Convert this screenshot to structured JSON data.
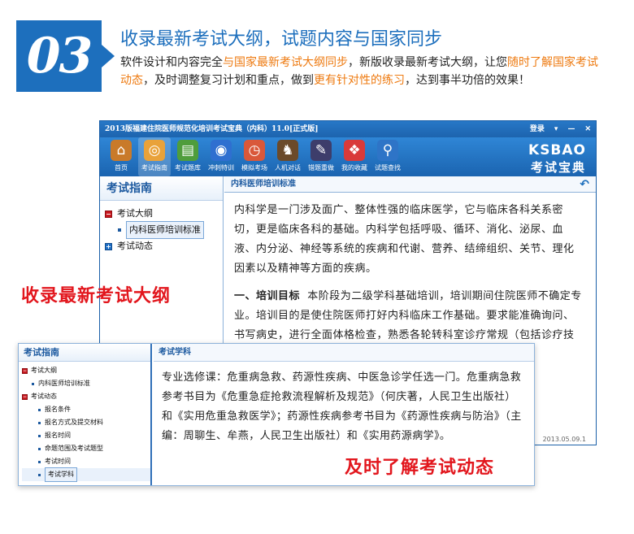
{
  "promo": {
    "number": "03",
    "headline": "收录最新考试大纲，试题内容与国家同步",
    "desc_parts": [
      {
        "text": "软件设计和内容完全",
        "hl": false
      },
      {
        "text": "与国家最新考试大纲同步",
        "hl": true
      },
      {
        "text": "，新版收录最新考试大纲，让您",
        "hl": false
      },
      {
        "text": "随时了解国家考试动态",
        "hl": true
      },
      {
        "text": "，及时调整复习计划和重点，做到",
        "hl": false
      },
      {
        "text": "更有针对性的练习",
        "hl": true
      },
      {
        "text": "，达到事半功倍的效果！",
        "hl": false
      }
    ],
    "highlight_color": "#ee7a10",
    "accent_color": "#1d6fbd"
  },
  "app": {
    "title": "2013版福建住院医师规范化培训考试宝典（内科）11.0[正式版]",
    "login": "登录",
    "controls": [
      "▾",
      "—",
      "✕"
    ],
    "toolbar": [
      {
        "label": "首页",
        "icon": "home-icon",
        "glyph": "⌂",
        "bg": "#c97a2a",
        "active": false
      },
      {
        "label": "考试指南",
        "icon": "compass-icon",
        "glyph": "◎",
        "bg": "#e9a23a",
        "active": true
      },
      {
        "label": "考试题库",
        "icon": "books-icon",
        "glyph": "▤",
        "bg": "#4f9d3c",
        "active": false
      },
      {
        "label": "冲刺特训",
        "icon": "globe-icon",
        "glyph": "◉",
        "bg": "#2f6fd0",
        "active": false
      },
      {
        "label": "模拟考场",
        "icon": "clock-icon",
        "glyph": "◷",
        "bg": "#d9583a",
        "active": false
      },
      {
        "label": "人机对话",
        "icon": "chess-icon",
        "glyph": "♞",
        "bg": "#6b4a2a",
        "active": false
      },
      {
        "label": "错题重做",
        "icon": "pen-icon",
        "glyph": "✎",
        "bg": "#3d3d6b",
        "active": false
      },
      {
        "label": "我的收藏",
        "icon": "gift-icon",
        "glyph": "❖",
        "bg": "#d93a3a",
        "active": false
      },
      {
        "label": "试题查找",
        "icon": "magnifier-icon",
        "glyph": "⚲",
        "bg": "#2e74c7",
        "active": false
      }
    ],
    "brand_en": "KSBAO",
    "brand_cn": "考试宝典",
    "sidebar": {
      "title": "考试指南",
      "items": [
        {
          "label": "考试大纲",
          "kind": "expanded"
        },
        {
          "label": "内科医师培训标准",
          "kind": "child-selected"
        },
        {
          "label": "考试动态",
          "kind": "collapsed"
        }
      ]
    },
    "content": {
      "heading": "内科医师培训标准",
      "para1": "内科学是一门涉及面广、整体性强的临床医学，它与临床各科关系密切，更是临床各科的基础。内科学包括呼吸、循环、消化、泌尿、血液、内分泌、神经等系统的疾病和代谢、营养、结缔组织、关节、理化因素以及精神等方面的疾病。",
      "para2_bold": "一、培训目标",
      "para2": "本阶段为二级学科基础培训，培训期间住院医师不确定专业。培训目的是使住院医师打好内科临床工作基础。要求能准确询问、书写病史，进行全面体格检查，熟悉各轮转科室诊疗常规（包括诊疗技术），基本掌握门、急诊常见疾病的诊断和处理，国外"
    },
    "status": "2013.05.09.1"
  },
  "overlay1": "收录最新考试大纲",
  "panel2": {
    "sidebar_title": "考试指南",
    "items": [
      {
        "label": "考试大纲",
        "kind": "expanded"
      },
      {
        "label": "内科医师培训标准",
        "kind": "child"
      },
      {
        "label": "考试动态",
        "kind": "expanded"
      },
      {
        "label": "报名条件",
        "kind": "grandchild"
      },
      {
        "label": "报名方式及提交材料",
        "kind": "grandchild"
      },
      {
        "label": "报名时间",
        "kind": "grandchild"
      },
      {
        "label": "命题范围及考试题型",
        "kind": "grandchild"
      },
      {
        "label": "考试时间",
        "kind": "grandchild"
      },
      {
        "label": "考试学科",
        "kind": "grandchild-selected"
      }
    ],
    "heading": "考试学科",
    "body": "专业选修课：危重病急救、药源性疾病、中医急诊学任选一门。危重病急救参考书目为《危重急症抢救流程解析及规范》（何庆著，人民卫生出版社）和《实用危重急救医学》；药源性疾病参考书目为《药源性疾病与防治》（主编：周聊生、牟燕，人民卫生出版社）和《实用药源病学》。"
  },
  "overlay2": "及时了解考试动态"
}
